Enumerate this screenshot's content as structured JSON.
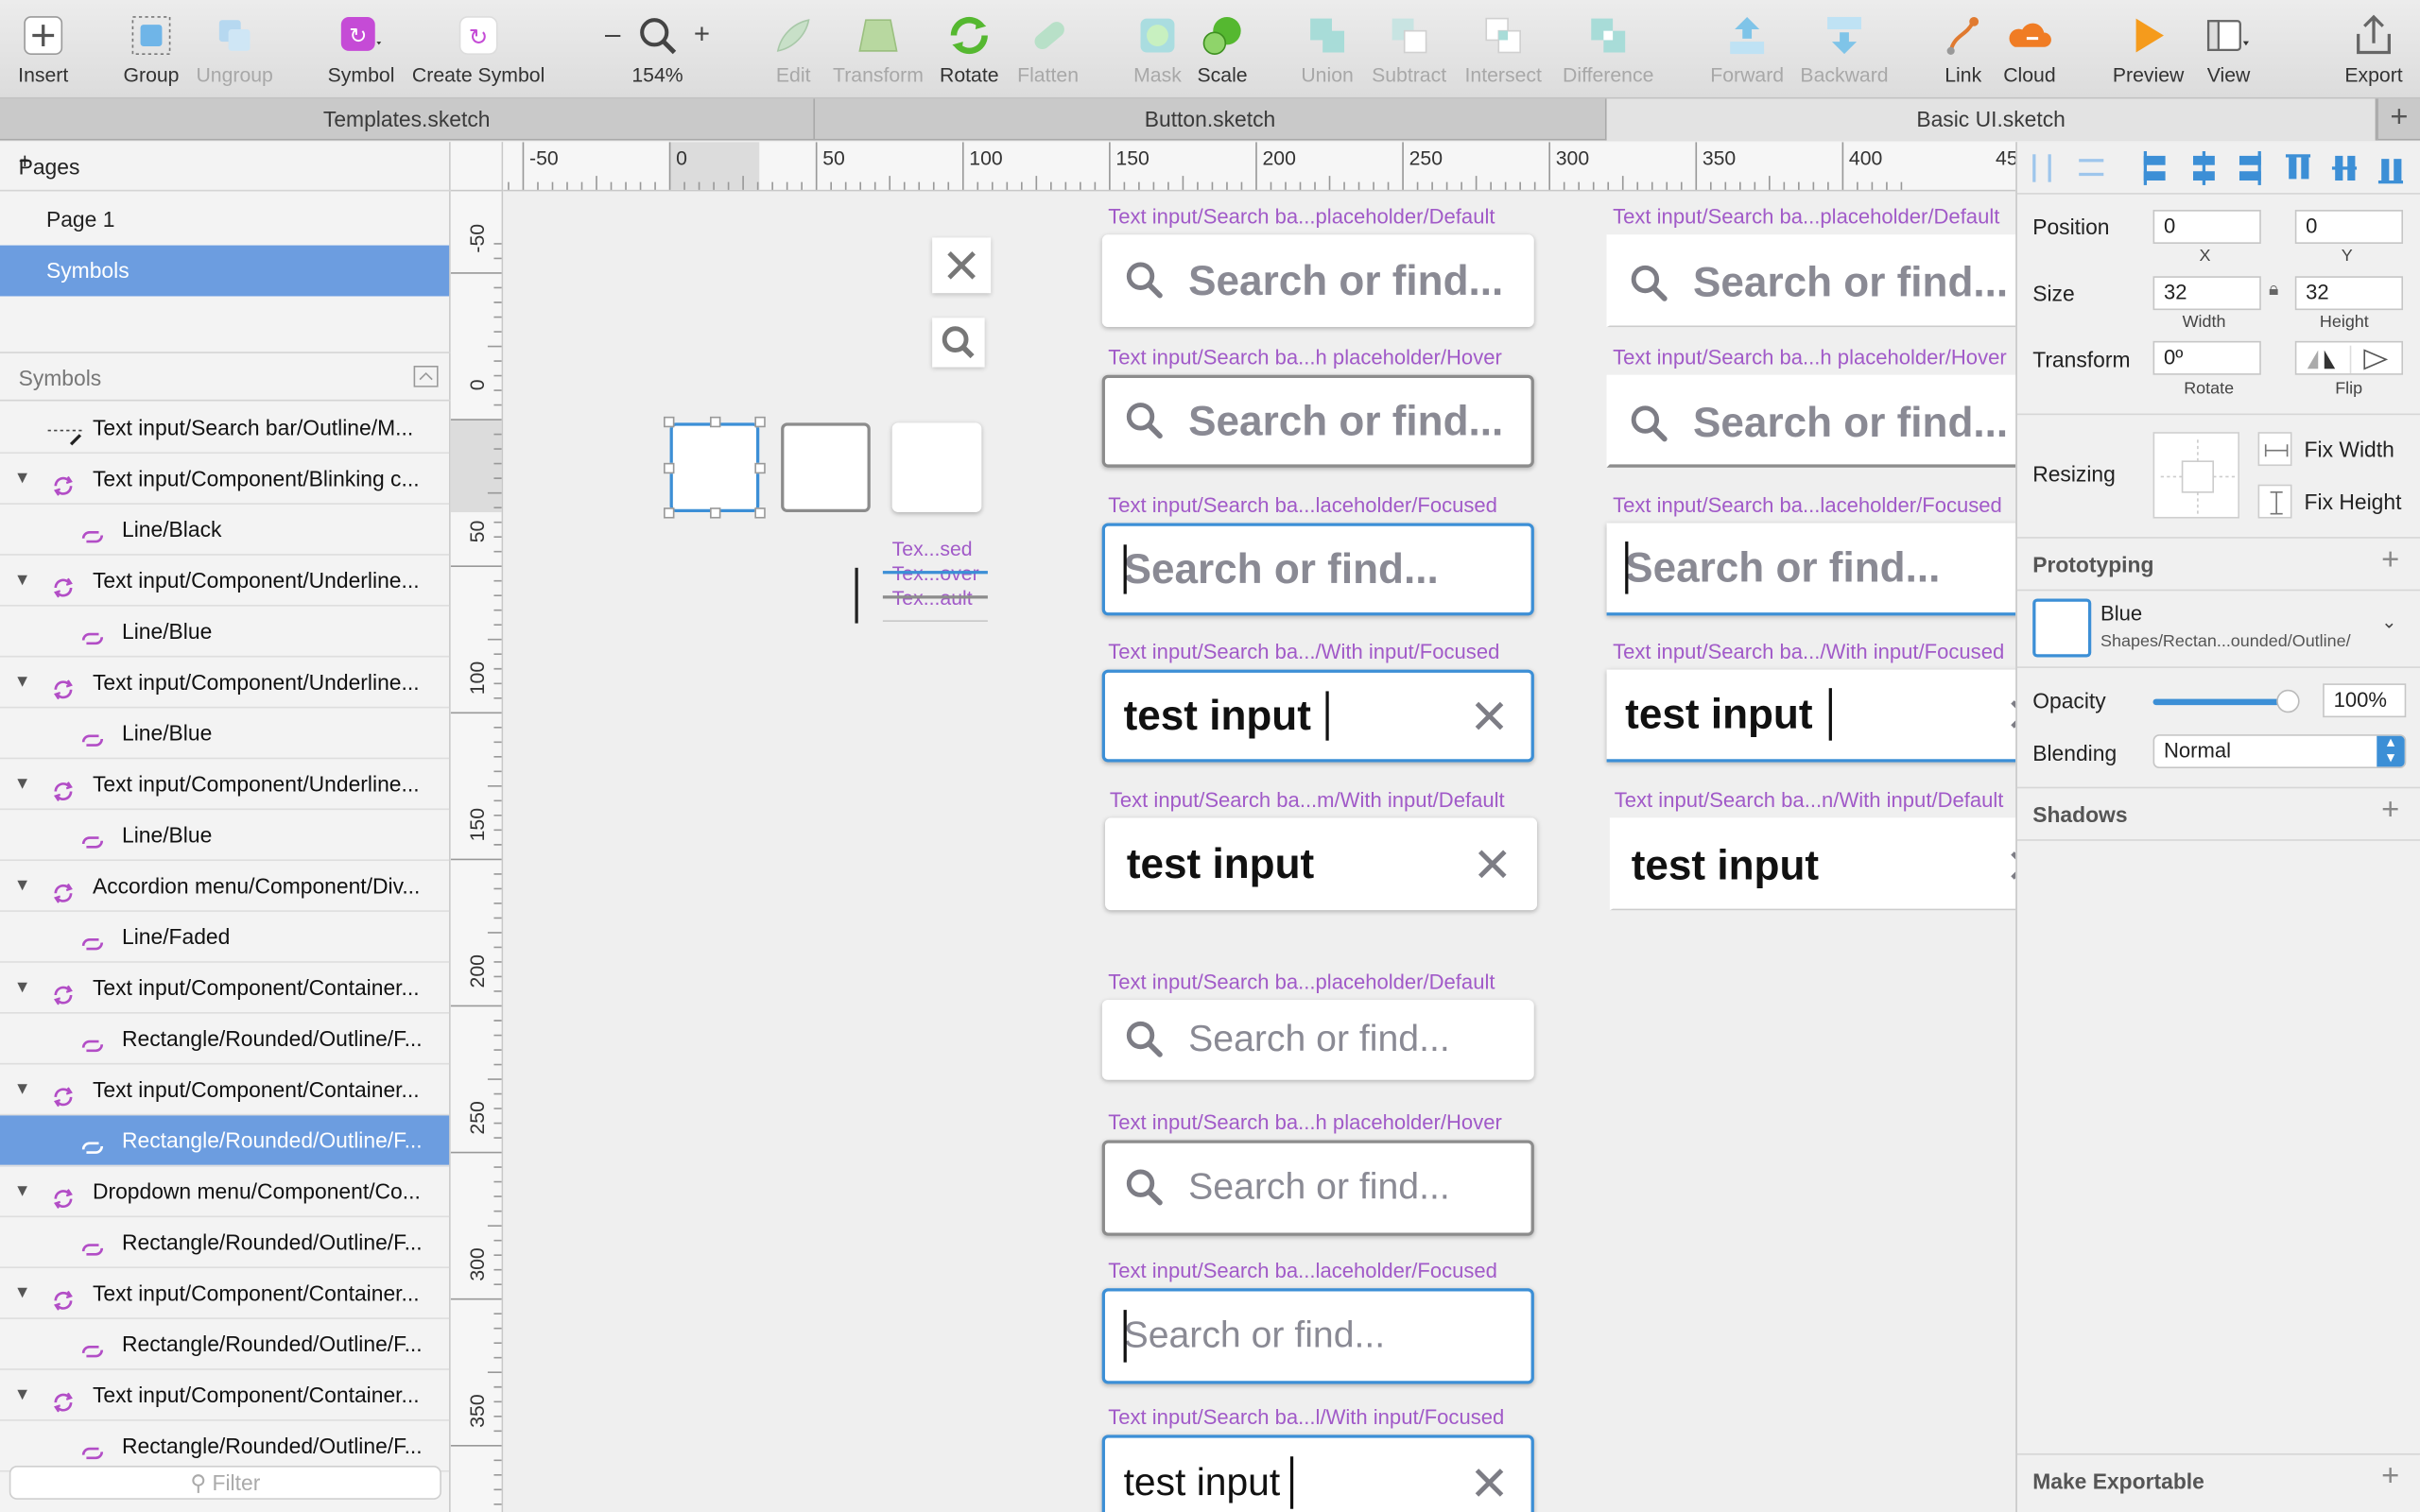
{
  "toolbar": {
    "items": [
      {
        "id": "insert",
        "label": "Insert",
        "icon": "plus-icon"
      },
      {
        "id": "group",
        "label": "Group",
        "icon": "group-icon"
      },
      {
        "id": "ungroup",
        "label": "Ungroup",
        "icon": "ungroup-icon"
      },
      {
        "id": "symbol",
        "label": "Symbol",
        "icon": "symbol-icon"
      },
      {
        "id": "create_symbol",
        "label": "Create Symbol",
        "icon": "create-symbol-icon"
      },
      {
        "id": "zoom",
        "label": "154%",
        "icon": "zoom-icon"
      },
      {
        "id": "edit",
        "label": "Edit",
        "icon": "edit-icon"
      },
      {
        "id": "transform",
        "label": "Transform",
        "icon": "transform-icon"
      },
      {
        "id": "rotate",
        "label": "Rotate",
        "icon": "rotate-icon"
      },
      {
        "id": "flatten",
        "label": "Flatten",
        "icon": "flatten-icon"
      },
      {
        "id": "mask",
        "label": "Mask",
        "icon": "mask-icon"
      },
      {
        "id": "scale",
        "label": "Scale",
        "icon": "scale-icon"
      },
      {
        "id": "union",
        "label": "Union",
        "icon": "union-icon"
      },
      {
        "id": "subtract",
        "label": "Subtract",
        "icon": "subtract-icon"
      },
      {
        "id": "intersect",
        "label": "Intersect",
        "icon": "intersect-icon"
      },
      {
        "id": "difference",
        "label": "Difference",
        "icon": "difference-icon"
      },
      {
        "id": "forward",
        "label": "Forward",
        "icon": "forward-icon"
      },
      {
        "id": "backward",
        "label": "Backward",
        "icon": "backward-icon"
      },
      {
        "id": "link",
        "label": "Link",
        "icon": "link-icon"
      },
      {
        "id": "cloud",
        "label": "Cloud",
        "icon": "cloud-icon"
      },
      {
        "id": "preview",
        "label": "Preview",
        "icon": "preview-icon"
      },
      {
        "id": "view",
        "label": "View",
        "icon": "view-icon"
      },
      {
        "id": "export",
        "label": "Export",
        "icon": "export-icon"
      }
    ],
    "zoom_minus": "–",
    "zoom_plus": "+"
  },
  "tabs": [
    {
      "label": "Templates.sketch"
    },
    {
      "label": "Button.sketch"
    },
    {
      "label": "Basic UI.sketch"
    }
  ],
  "tab_add": "+",
  "sidebar": {
    "pages_title": "Pages",
    "pages": [
      {
        "label": "Page 1"
      },
      {
        "label": "Symbols"
      }
    ],
    "symbols_title": "Symbols",
    "layers": [
      {
        "label": "Text input/Search bar/Outline/M...",
        "kind": "slice"
      },
      {
        "label": "Text input/Component/Blinking c...",
        "kind": "symbol"
      },
      {
        "label": "Line/Black",
        "kind": "instance"
      },
      {
        "label": "Text input/Component/Underline...",
        "kind": "symbol"
      },
      {
        "label": "Line/Blue",
        "kind": "instance"
      },
      {
        "label": "Text input/Component/Underline...",
        "kind": "symbol"
      },
      {
        "label": "Line/Blue",
        "kind": "instance"
      },
      {
        "label": "Text input/Component/Underline...",
        "kind": "symbol"
      },
      {
        "label": "Line/Blue",
        "kind": "instance"
      },
      {
        "label": "Accordion menu/Component/Div...",
        "kind": "symbol"
      },
      {
        "label": "Line/Faded",
        "kind": "instance"
      },
      {
        "label": "Text input/Component/Container...",
        "kind": "symbol"
      },
      {
        "label": "Rectangle/Rounded/Outline/F...",
        "kind": "instance"
      },
      {
        "label": "Text input/Component/Container...",
        "kind": "symbol"
      },
      {
        "label": "Rectangle/Rounded/Outline/F...",
        "kind": "instance"
      },
      {
        "label": "Dropdown menu/Component/Co...",
        "kind": "symbol"
      },
      {
        "label": "Rectangle/Rounded/Outline/F...",
        "kind": "instance"
      },
      {
        "label": "Text input/Component/Container...",
        "kind": "symbol"
      },
      {
        "label": "Rectangle/Rounded/Outline/F...",
        "kind": "instance"
      },
      {
        "label": "Text input/Component/Container...",
        "kind": "symbol"
      },
      {
        "label": "Rectangle/Rounded/Outline/F...",
        "kind": "instance"
      }
    ],
    "selected_page": 1,
    "selected_layer": 14,
    "filter_placeholder": "Filter"
  },
  "rulers": {
    "top": [
      "-50",
      "0",
      "50",
      "100",
      "150",
      "200",
      "250",
      "300",
      "350",
      "400",
      "45"
    ],
    "left": [
      "-50",
      "0",
      "50",
      "100",
      "150",
      "200",
      "250",
      "300",
      "350"
    ]
  },
  "canvas": {
    "small_labels": [
      "Tex...sed",
      "Tex...over",
      "Tex...ault"
    ],
    "col1": [
      {
        "label": "Text input/Search ba...placeholder/Default",
        "state": "default",
        "text": "Search or find...",
        "type": "ph-big",
        "search": true
      },
      {
        "label": "Text input/Search ba...h placeholder/Hover",
        "state": "hover",
        "text": "Search or find...",
        "type": "ph-big",
        "search": true
      },
      {
        "label": "Text input/Search ba...laceholder/Focused",
        "state": "focus",
        "text": "Search or find...",
        "type": "ph-big",
        "search": false
      },
      {
        "label": "Text input/Search ba.../With input/Focused",
        "state": "focus",
        "text": "test input",
        "type": "in-big",
        "clear": true
      },
      {
        "label": "Text input/Search ba...m/With input/Default",
        "state": "default",
        "text": "test input",
        "type": "in-big",
        "clear": true
      },
      {
        "label": "Text input/Search ba...placeholder/Default",
        "state": "default",
        "text": "Search or find...",
        "type": "ph-small",
        "search": true
      },
      {
        "label": "Text input/Search ba...h placeholder/Hover",
        "state": "hover",
        "text": "Search or find...",
        "type": "ph-small",
        "search": true
      },
      {
        "label": "Text input/Search ba...laceholder/Focused",
        "state": "focus",
        "text": "Search or find...",
        "type": "ph-small",
        "search": false
      },
      {
        "label": "Text input/Search ba...l/With input/Focused",
        "state": "focus",
        "text": "test input",
        "type": "in-small",
        "clear": true
      }
    ],
    "col2": [
      {
        "label": "Text input/Search ba...placeholder/Default",
        "text": "Search or find..."
      },
      {
        "label": "Text input/Search ba...h placeholder/Hover",
        "text": "Search or find..."
      },
      {
        "label": "Text input/Search ba...laceholder/Focused",
        "text": "Search or find..."
      },
      {
        "label": "Text input/Search ba.../With input/Focused",
        "text": "test input"
      },
      {
        "label": "Text input/Search ba...n/With input/Default",
        "text": "test input"
      }
    ]
  },
  "inspector": {
    "position_label": "Position",
    "x": "0",
    "y": "0",
    "x_label": "X",
    "y_label": "Y",
    "size_label": "Size",
    "width": "32",
    "height": "32",
    "width_label": "Width",
    "height_label": "Height",
    "transform_label": "Transform",
    "rotate": "0º",
    "rotate_label": "Rotate",
    "flip_label": "Flip",
    "resizing_label": "Resizing",
    "fix_width": "Fix Width",
    "fix_height": "Fix Height",
    "prototyping_label": "Prototyping",
    "style_name": "Blue",
    "style_path": "Shapes/Rectan...ounded/Outline/",
    "opacity_label": "Opacity",
    "opacity": "100%",
    "opacity_value": 1.0,
    "blending_label": "Blending",
    "blending": "Normal",
    "shadows_label": "Shadows",
    "exportable_label": "Make Exportable"
  },
  "colors": {
    "accent": "#3c8fd6",
    "selection": "#6c9de0",
    "artboard_label": "#a15ac8",
    "placeholder": "#8a8a94"
  }
}
